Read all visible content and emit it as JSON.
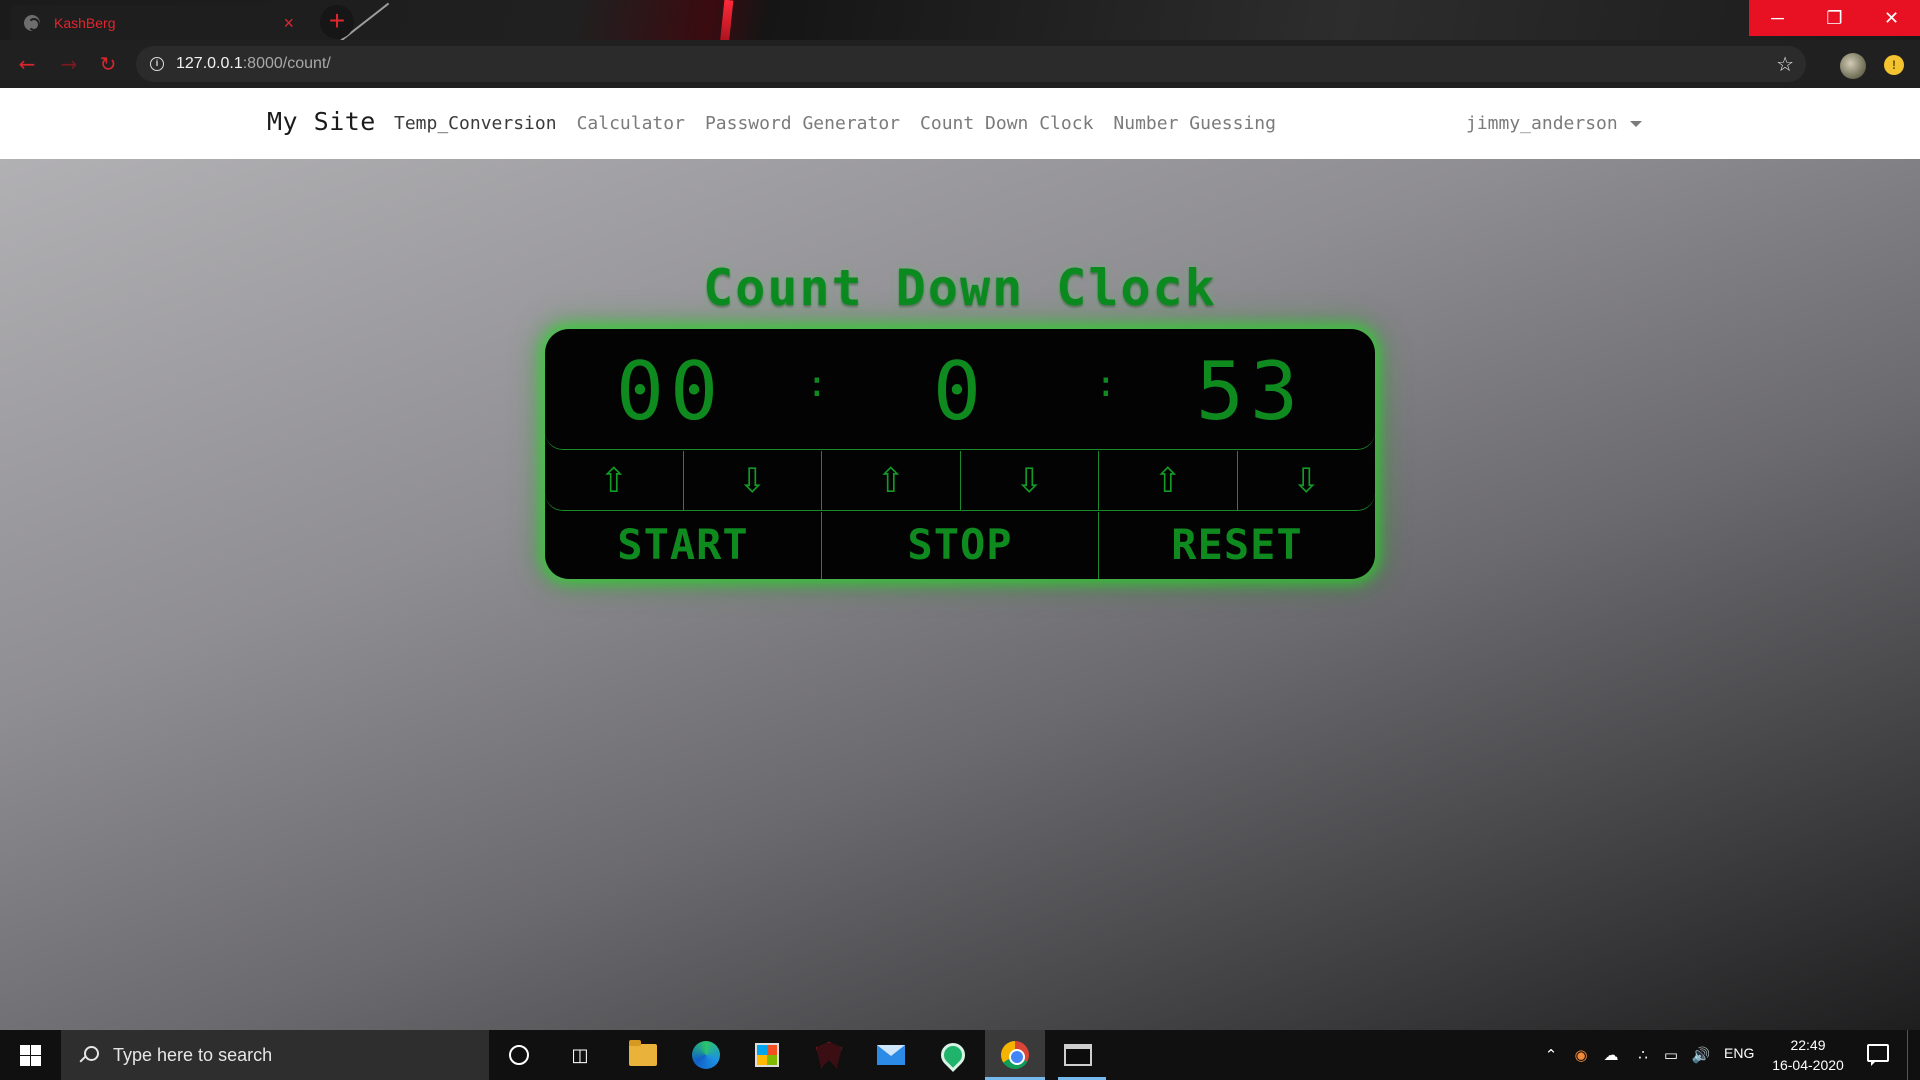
{
  "browser": {
    "tab_title": "KashBerg",
    "tab_close": "×",
    "new_tab": "+",
    "url_host": "127.0.0.1",
    "url_path": ":8000/count/",
    "window_controls": {
      "minimize": "─",
      "maximize": "❐",
      "close": "✕"
    }
  },
  "site": {
    "brand": "My Site",
    "nav_links": [
      "Temp_Conversion",
      "Calculator",
      "Password Generator",
      "Count Down Clock",
      "Number Guessing"
    ],
    "user": "jimmy_anderson"
  },
  "clock": {
    "title": "Count Down Clock",
    "hours": "00",
    "minutes": "0",
    "seconds": "53",
    "separator": ":",
    "arrows": [
      "⇧",
      "⇩",
      "⇧",
      "⇩",
      "⇧",
      "⇩"
    ],
    "buttons": {
      "start": "START",
      "stop": "STOP",
      "reset": "RESET"
    },
    "accent_color": "#0e8a1f"
  },
  "taskbar": {
    "search_placeholder": "Type here to search",
    "language": "ENG",
    "time": "22:49",
    "date": "16-04-2020",
    "pinned_icons": [
      "cortana-icon",
      "task-view-icon",
      "file-explorer-icon",
      "edge-icon",
      "store-icon",
      "predator-icon",
      "mail-icon",
      "maps-icon",
      "chrome-icon",
      "terminal-icon"
    ]
  },
  "colors": {
    "browser_accent": "#e0262f",
    "taskbar_highlight": "#76b9ed"
  }
}
